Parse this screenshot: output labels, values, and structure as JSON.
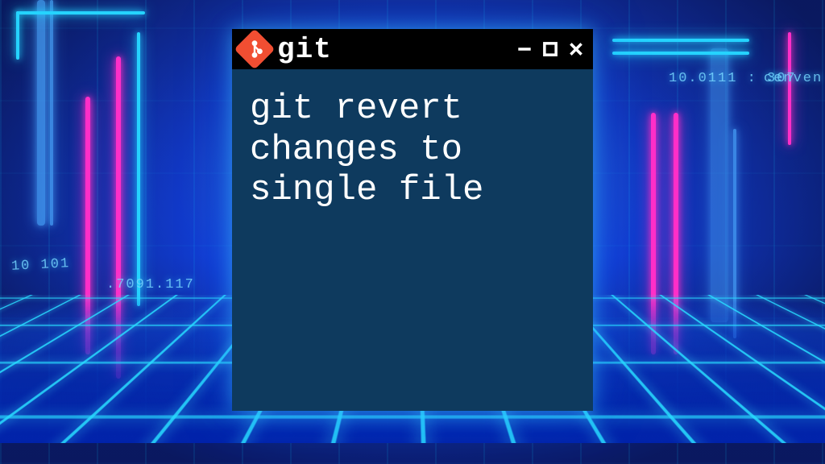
{
  "window": {
    "title": "git",
    "command": "git revert changes to single file"
  },
  "background": {
    "codebits": {
      "topRight1": "10.0111 : 307",
      "topRight2": "cenven",
      "left1": ".7091.117",
      "left2": "10 101"
    }
  },
  "colors": {
    "magenta": "#ff2ec8",
    "cyan": "#25d3ff",
    "terminalBg": "#0e3a5e",
    "gitOrange": "#f14e32"
  }
}
